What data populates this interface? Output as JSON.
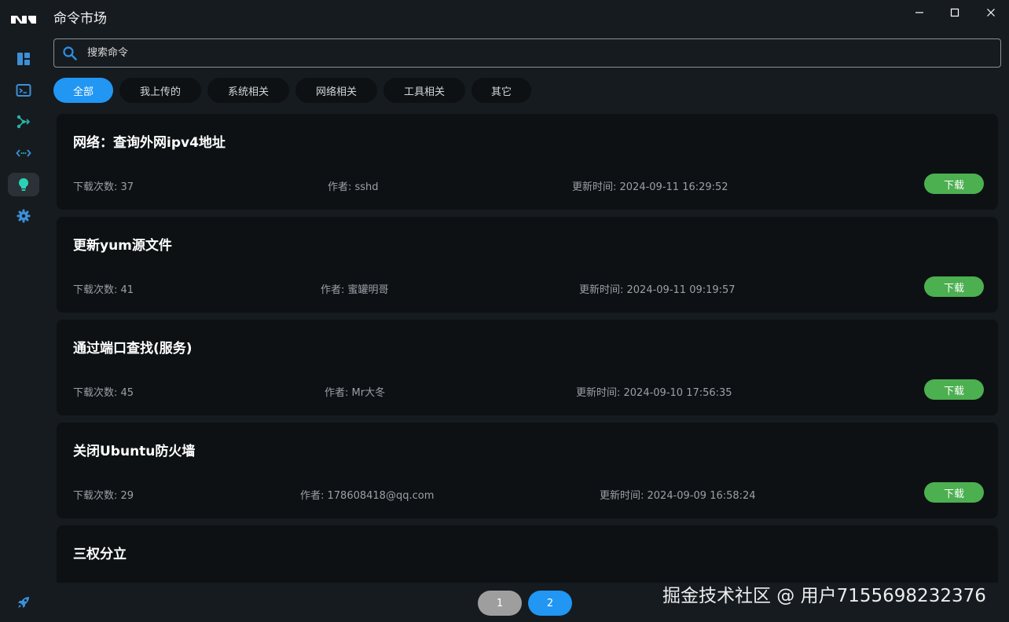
{
  "window": {
    "title": "命令市场"
  },
  "search": {
    "placeholder": "搜索命令",
    "value": ""
  },
  "tabs": [
    {
      "label": "全部",
      "active": true
    },
    {
      "label": "我上传的",
      "active": false
    },
    {
      "label": "系统相关",
      "active": false
    },
    {
      "label": "网络相关",
      "active": false
    },
    {
      "label": "工具相关",
      "active": false
    },
    {
      "label": "其它",
      "active": false
    }
  ],
  "sidebar": {
    "items": [
      {
        "icon": "dashboard-icon",
        "active": false
      },
      {
        "icon": "terminal-icon",
        "active": false
      },
      {
        "icon": "branch-icon",
        "active": false
      },
      {
        "icon": "code-arrows-icon",
        "active": false
      },
      {
        "icon": "lightbulb-icon",
        "active": true
      },
      {
        "icon": "gear-icon",
        "active": false
      }
    ],
    "bottom_icon": "rocket-icon"
  },
  "commands": [
    {
      "title": "网络：查询外网ipv4地址",
      "downloads": "下载次数: 37",
      "author": "作者: sshd",
      "updated": "更新时间: 2024-09-11 16:29:52",
      "button": "下载"
    },
    {
      "title": "更新yum源文件",
      "downloads": "下载次数: 41",
      "author": "作者: 蜜罐明哥",
      "updated": "更新时间: 2024-09-11 09:19:57",
      "button": "下载"
    },
    {
      "title": "通过端口查找(服务)",
      "downloads": "下载次数: 45",
      "author": "作者: Mr大冬",
      "updated": "更新时间: 2024-09-10 17:56:35",
      "button": "下载"
    },
    {
      "title": "关闭Ubuntu防火墙",
      "downloads": "下载次数: 29",
      "author": "作者: 178608418@qq.com",
      "updated": "更新时间: 2024-09-09 16:58:24",
      "button": "下载"
    },
    {
      "title": "三权分立"
    }
  ],
  "pagination": {
    "pages": [
      "1",
      "2"
    ],
    "current": "2"
  },
  "watermark": "掘金技术社区 @ 用户7155698232376",
  "colors": {
    "accent": "#2196f3",
    "download": "#4caf50",
    "background": "#161b1f",
    "card": "#0d1114"
  }
}
